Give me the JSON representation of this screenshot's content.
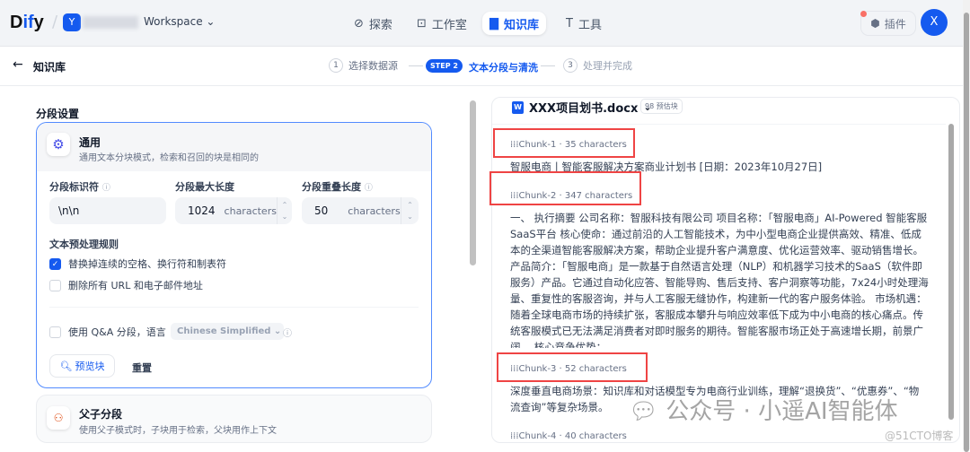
{
  "header": {
    "logo": "Dify",
    "logo_pre": "D",
    "logo_mid": "if",
    "logo_post": "y",
    "workspace_initial": "Y",
    "workspace": "Workspace",
    "nav": [
      {
        "label": "探索"
      },
      {
        "label": "工作室"
      },
      {
        "label": "知识库"
      },
      {
        "label": "工具"
      }
    ],
    "plugins": "插件",
    "avatar": "X"
  },
  "subheader": {
    "back": "知识库",
    "steps": [
      {
        "num": "1",
        "label": "选择数据源"
      },
      {
        "num": "STEP 2",
        "label": "文本分段与清洗"
      },
      {
        "num": "3",
        "label": "处理并完成"
      }
    ]
  },
  "settings": {
    "title": "分段设置",
    "general": {
      "title": "通用",
      "desc": "通用文本分块模式，检索和召回的块是相同的"
    },
    "separator": {
      "label": "分段标识符",
      "value": "\\n\\n"
    },
    "max_length": {
      "label": "分段最大长度",
      "value": "1024",
      "unit": "characters"
    },
    "overlap": {
      "label": "分段重叠长度",
      "value": "50",
      "unit": "characters"
    },
    "rules_title": "文本预处理规则",
    "rules": [
      {
        "label": "替换掉连续的空格、换行符和制表符",
        "checked": true
      },
      {
        "label": "删除所有 URL 和电子邮件地址",
        "checked": false
      }
    ],
    "qa": {
      "label": "使用 Q&A 分段，语言",
      "language": "Chinese Simplified"
    },
    "preview_btn": "预览块",
    "reset_btn": "重置",
    "parent_child": {
      "title": "父子分段",
      "desc": "使用父子模式时，子块用于检索，父块用作上下文"
    }
  },
  "preview": {
    "file": "XXX项目划书.docx",
    "estimate": "98 预估块",
    "chunks": [
      {
        "label": "Chunk-1",
        "chars": "35 characters",
        "text": "智服电商丨智能客服解决方案商业计划书 [日期：2023年10月27日]"
      },
      {
        "label": "Chunk-2",
        "chars": "347 characters",
        "text": "一、 执行摘要 公司名称：智服科技有限公司 项目名称：「智服电商」AI-Powered 智能客服SaaS平台 核心使命：通过前沿的人工智能技术，为中小型电商企业提供高效、精准、低成本的全渠道智能客服解决方案，帮助企业提升客户满意度、优化运营效率、驱动销售增长。 产品简介：「智服电商」是一款基于自然语言处理（NLP）和机器学习技术的SaaS（软件即服务）产品。它通过自动化应答、智能导购、售后支持、客户洞察等功能，7x24小时处理海量、重复性的客服咨询，并与人工客服无缝协作，构建新一代的客户服务体验。 市场机遇：随着全球电商市场的持续扩张，客服成本攀升与响应效率低下成为中小电商的核心痛点。传统客服模式已无法满足消费者对即时服务的期待。智能客服市场正处于高速增长期，前景广阔。 核心竞争优势："
      },
      {
        "label": "Chunk-3",
        "chars": "52 characters",
        "text": "深度垂直电商场景：知识库和对话模型专为电商行业训练，理解“退换货”、“优惠券”、“物流查询”等复杂场景。"
      },
      {
        "label": "Chunk-4",
        "chars": "40 characters"
      }
    ]
  },
  "watermark": {
    "text": "公众号 · 小遥AI智能体",
    "source": "@51CTO博客"
  }
}
